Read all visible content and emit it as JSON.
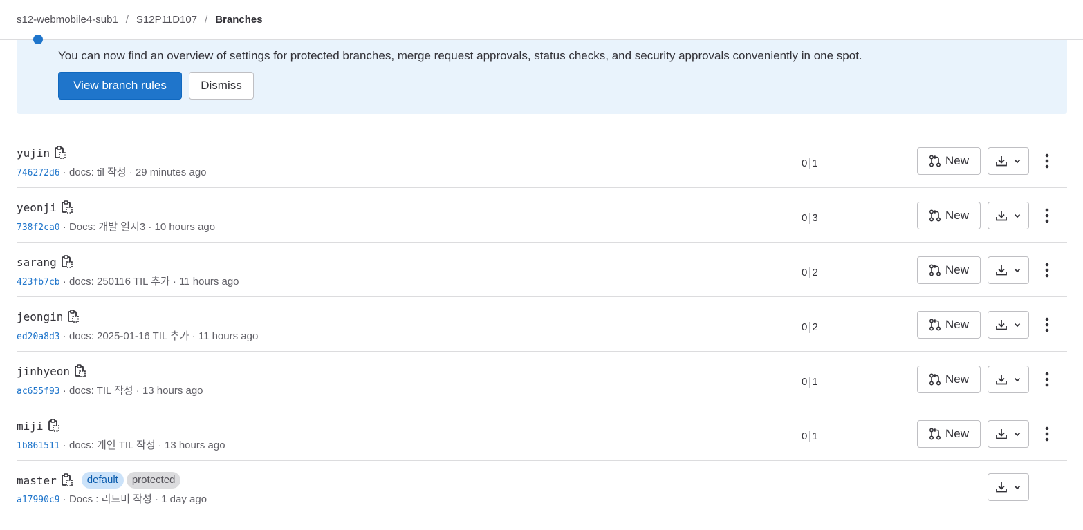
{
  "breadcrumb": {
    "items": [
      "s12-webmobile4-sub1",
      "S12P11D107"
    ],
    "current": "Branches",
    "separator": "/"
  },
  "banner": {
    "text": "You can now find an overview of settings for protected branches, merge request approvals, status checks, and security approvals conveniently in one spot.",
    "primary_label": "View branch rules",
    "dismiss_label": "Dismiss"
  },
  "colors": {
    "accent": "#1f75cb",
    "banner_bg": "#e9f3fc",
    "badge_default_bg": "#cbe2f9",
    "badge_protected_bg": "#dcdcde"
  },
  "new_label": "New",
  "branches": [
    {
      "name": "yujin",
      "sha": "746272d6",
      "message": "docs: til 작성",
      "time": "29 minutes ago",
      "behind": "0",
      "ahead": "1"
    },
    {
      "name": "yeonji",
      "sha": "738f2ca0",
      "message": "Docs: 개발 일지3",
      "time": "10 hours ago",
      "behind": "0",
      "ahead": "3"
    },
    {
      "name": "sarang",
      "sha": "423fb7cb",
      "message": "docs: 250116 TIL 추가",
      "time": "11 hours ago",
      "behind": "0",
      "ahead": "2"
    },
    {
      "name": "jeongin",
      "sha": "ed20a8d3",
      "message": "docs: 2025-01-16 TIL 추가",
      "time": "11 hours ago",
      "behind": "0",
      "ahead": "2"
    },
    {
      "name": "jinhyeon",
      "sha": "ac655f93",
      "message": "docs: TIL 작성",
      "time": "13 hours ago",
      "behind": "0",
      "ahead": "1"
    },
    {
      "name": "miji",
      "sha": "1b861511",
      "message": "docs: 개인 TIL 작성",
      "time": "13 hours ago",
      "behind": "0",
      "ahead": "1"
    }
  ],
  "master": {
    "name": "master",
    "sha": "a17990c9",
    "message": "Docs : 리드미 작성",
    "time": "1 day ago",
    "badge_default": "default",
    "badge_protected": "protected"
  },
  "icons": {
    "copy": "clipboard-icon",
    "merge_request": "merge-request-icon",
    "download": "download-icon",
    "chevron": "chevron-down-icon",
    "kebab": "ellipsis-v-icon"
  }
}
